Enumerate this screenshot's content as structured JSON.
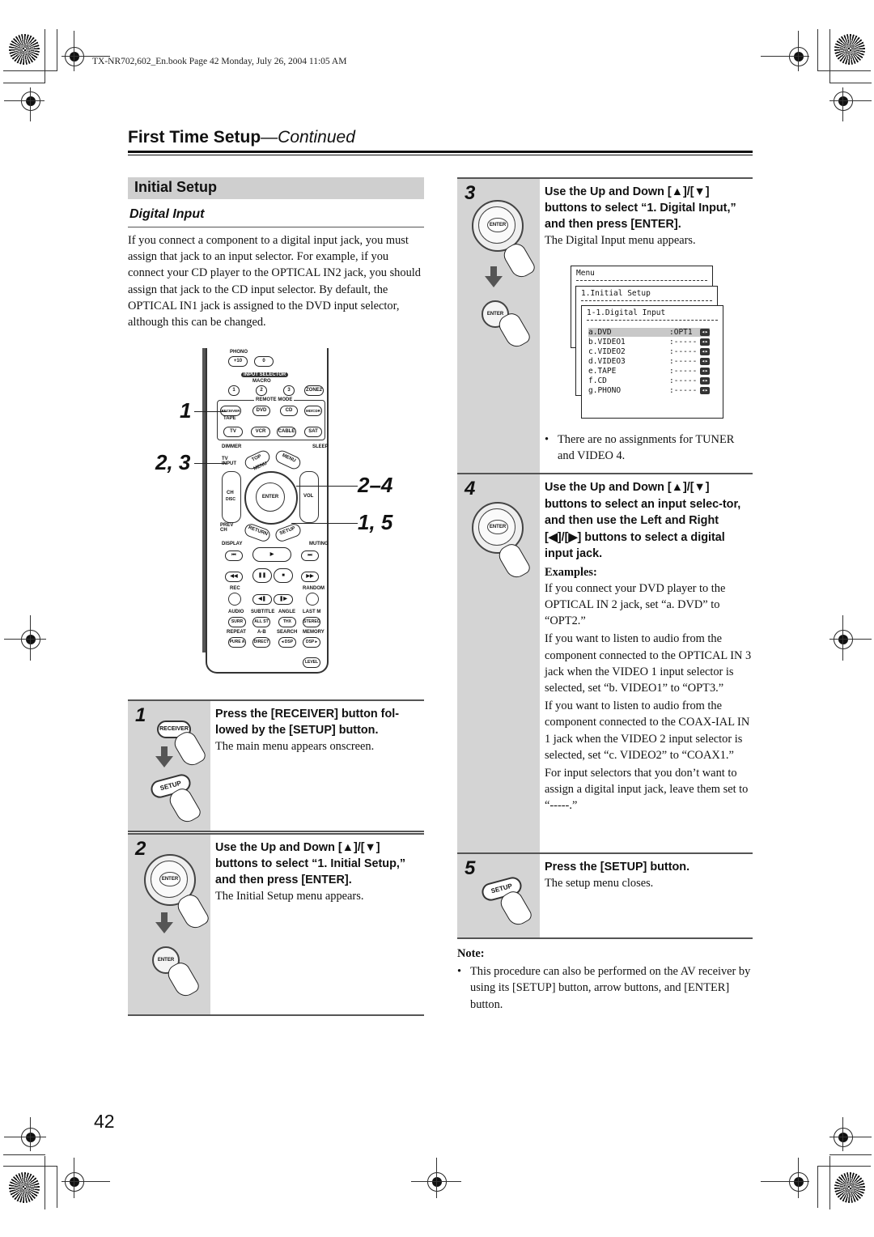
{
  "print_header": "TX-NR702,602_En.book  Page 42  Monday, July 26, 2004  11:05 AM",
  "page": {
    "title": "First Time Setup",
    "title_suffix": "—Continued",
    "section": "Initial Setup",
    "subsection": "Digital Input",
    "intro": "If you connect a component to a digital input jack, you must assign that jack to an input selector. For example, if you connect your CD player to the OPTICAL IN2 jack, you should assign that jack to the CD input selector. By default, the OPTICAL IN1 jack is assigned to the DVD input selector, although this can be changed.",
    "page_number": "42"
  },
  "remote": {
    "labels": {
      "phono": "PHONO",
      "plus10": "+10",
      "zero": "0",
      "input_selector": "INPUT SELECTOR",
      "macro": "MACRO",
      "m1": "1",
      "m2": "2",
      "m3": "3",
      "zone2": "ZONE2",
      "remote_mode": "REMOTE MODE",
      "receiver": "RECEIVER",
      "tape": "TAPE",
      "dvd": "DVD",
      "cd": "CD",
      "mdcdr": "MD/CDR",
      "tv": "TV",
      "vcr": "VCR",
      "cable": "CABLE",
      "sat": "SAT",
      "dimmer": "DIMMER",
      "sleep": "SLEEP",
      "tv_input": "TV INPUT",
      "top_menu": "TOP MENU",
      "menu": "MENU",
      "ch": "CH",
      "disc": "DISC",
      "enter": "ENTER",
      "vol": "VOL",
      "prev_ch": "PREV CH",
      "return": "RETURN",
      "setup": "SETUP",
      "display": "DISPLAY",
      "muting": "MUTING",
      "rec": "REC",
      "random": "RANDOM",
      "audio": "AUDIO",
      "subtitle": "SUBTITLE",
      "angle": "ANGLE",
      "last_m": "LAST M",
      "surr": "SURR",
      "all_st": "ALL ST",
      "thx": "THX",
      "stereo": "STEREO",
      "repeat": "REPEAT",
      "ab": "A-B",
      "search": "SEARCH",
      "memory": "MEMORY",
      "pure_a": "PURE A",
      "direct": "DIRECT",
      "dsp_left": "◂ DSP",
      "dsp_right": "DSP ▸",
      "level": "LEVEL"
    },
    "callouts": [
      "1",
      "2, 3",
      "2–4",
      "1, 5"
    ]
  },
  "steps": [
    {
      "number": "1",
      "instruction": "Press the [RECEIVER] button fol-lowed by the [SETUP] button.",
      "description": "The main menu appears onscreen.",
      "icons": {
        "top": "RECEIVER",
        "bottom": "SETUP"
      }
    },
    {
      "number": "2",
      "instruction": "Use the Up and Down [▲]/[▼] buttons to select “1. Initial Setup,” and then press [ENTER].",
      "description": "The Initial Setup menu appears.",
      "icons": {
        "top": "ENTER",
        "bottom": "ENTER"
      }
    },
    {
      "number": "3",
      "instruction": "Use the Up and Down [▲]/[▼] buttons to select “1. Digital Input,” and then press [ENTER].",
      "description": "The Digital Input menu appears.",
      "icons": {
        "top": "ENTER",
        "bottom": "ENTER"
      },
      "osd": {
        "menu_title": "Menu",
        "level1_title": "1.Initial Setup",
        "level2_title": "1-1.Digital Input",
        "rows": [
          {
            "label": "a.DVD",
            "value": ":OPT1",
            "selected": true
          },
          {
            "label": "b.VIDEO1",
            "value": ":-----",
            "selected": false
          },
          {
            "label": "c.VIDEO2",
            "value": ":-----",
            "selected": false
          },
          {
            "label": "d.VIDEO3",
            "value": ":-----",
            "selected": false
          },
          {
            "label": "e.TAPE",
            "value": ":-----",
            "selected": false
          },
          {
            "label": "f.CD",
            "value": ":-----",
            "selected": false
          },
          {
            "label": "g.PHONO",
            "value": ":-----",
            "selected": false
          }
        ],
        "lr_glyph": "◂▸"
      },
      "bullet": "There are no assignments for TUNER and VIDEO 4."
    },
    {
      "number": "4",
      "instruction": "Use the Up and Down [▲]/[▼] buttons to select an input selec-tor, and then use the Left and Right [◀]/[▶] buttons to select a digital input jack.",
      "examples_label": "Examples:",
      "examples": [
        "If you connect your DVD player to the OPTICAL IN 2 jack, set “a. DVD” to “OPT2.”",
        "If you want to listen to audio from the component connected to the OPTICAL IN 3 jack when the VIDEO 1 input selector is selected, set “b. VIDEO1” to “OPT3.”",
        "If you want to listen to audio from the component connected to the COAX-IAL IN 1 jack when the VIDEO 2 input selector is selected, set “c. VIDEO2” to “COAX1.”",
        "For input selectors that you don’t want to assign a digital input jack, leave them set to “-----.”"
      ],
      "icons": {
        "top": "ENTER"
      }
    },
    {
      "number": "5",
      "instruction": "Press the [SETUP] button.",
      "description": "The setup menu closes.",
      "icons": {
        "top": "SETUP"
      }
    }
  ],
  "note": {
    "label": "Note:",
    "items": [
      "This procedure can also be performed on the AV receiver by using its [SETUP] button, arrow buttons, and [ENTER] button."
    ]
  }
}
